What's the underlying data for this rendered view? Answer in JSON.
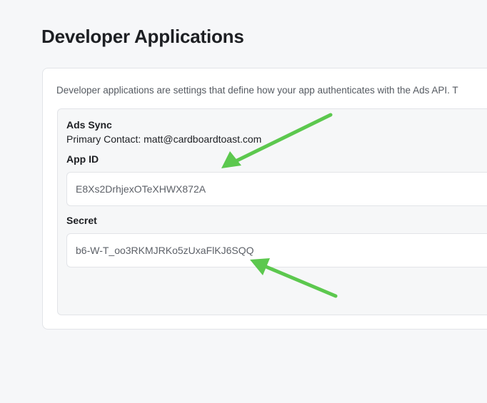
{
  "page": {
    "title": "Developer Applications"
  },
  "card": {
    "intro": "Developer applications are settings that define how your app authenticates with the Ads API. T"
  },
  "application": {
    "name": "Ads Sync",
    "contact": "Primary Contact: matt@cardboardtoast.com",
    "app_id_label": "App ID",
    "app_id_value": "E8Xs2DrhjexOTeXHWX872A",
    "secret_label": "Secret",
    "secret_value": "b6-W-T_oo3RKMJRKo5zUxaFlKJ6SQQ"
  },
  "annotations": {
    "arrow_color": "#5cc84e"
  }
}
